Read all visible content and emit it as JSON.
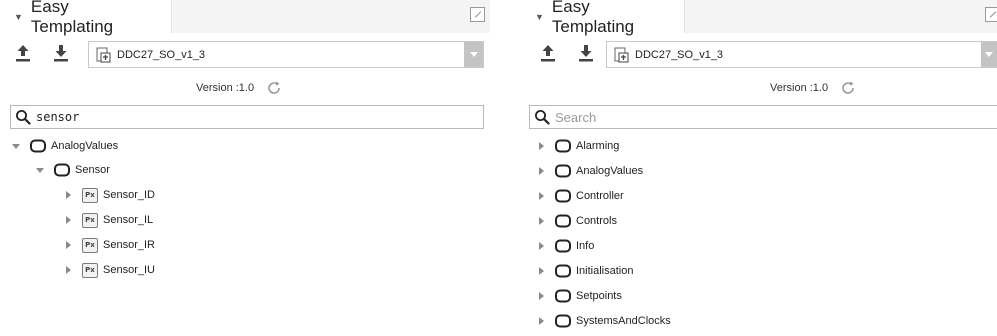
{
  "left_panel": {
    "title": "Easy Templating",
    "template_select": {
      "value": "DDC27_SO_v1_3"
    },
    "version_label": "Version :1.0",
    "search": {
      "value": "sensor",
      "placeholder": "Search"
    },
    "tree": {
      "root": {
        "label": "AnalogValues",
        "expanded": true
      },
      "child": {
        "label": "Sensor",
        "expanded": true
      },
      "leaves": [
        "Sensor_ID",
        "Sensor_IL",
        "Sensor_IR",
        "Sensor_IU"
      ]
    }
  },
  "right_panel": {
    "title": "Easy Templating",
    "template_select": {
      "value": "DDC27_SO_v1_3"
    },
    "version_label": "Version :1.0",
    "search": {
      "value": "",
      "placeholder": "Search"
    },
    "tree": {
      "items": [
        "Alarming",
        "AnalogValues",
        "Controller",
        "Controls",
        "Info",
        "Initialisation",
        "Setpoints",
        "SystemsAndClocks"
      ]
    }
  },
  "icons": {
    "tab_caret": "caret-down-small",
    "expand": "expand-icon",
    "upload": "upload-icon",
    "download": "download-icon",
    "template": "template-file-icon",
    "refresh": "refresh-icon",
    "search": "search-icon",
    "folder": "folder-icon",
    "point": "px-point-icon"
  },
  "colors": {
    "header_bg": "#f4f4f4",
    "arrow_gray": "#8a8a8a",
    "select_arrow_bg": "#c4c4c4"
  }
}
